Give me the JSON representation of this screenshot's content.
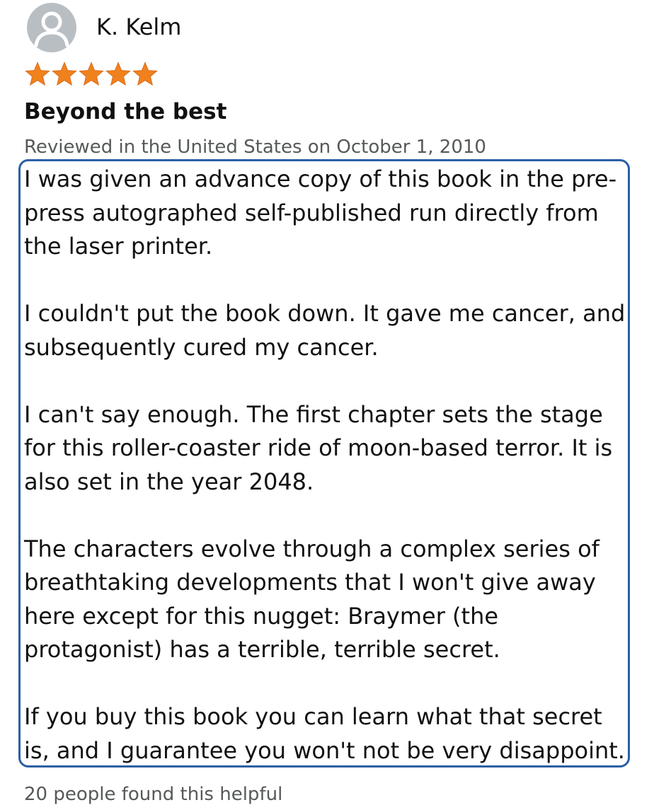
{
  "reviewer": {
    "name": "K. Kelm",
    "avatar_icon": "default-user-avatar-icon"
  },
  "rating": {
    "stars": 5,
    "max": 5,
    "color": "#f0821e"
  },
  "review": {
    "title": "Beyond the best",
    "meta": "Reviewed in the United States on October 1, 2010",
    "paragraphs": [
      "I was given an advance copy of this book in the pre-press autographed self-published run directly from the laser printer.",
      "I couldn't put the book down. It gave me cancer, and subsequently cured my cancer.",
      "I can't say enough. The first chapter sets the stage for this roller-coaster ride of moon-based terror. It is also set in the year 2048.",
      "The characters evolve through a complex series of breathtaking developments that I won't give away here except for this nugget: Braymer (the protagonist) has a terrible, terrible secret.",
      "If you buy this book you can learn what that secret is, and I guarantee you won't not be very disappoint."
    ],
    "highlight_color": "#2a5fa5"
  },
  "footer": {
    "helpful_text": "20 people found this helpful"
  }
}
